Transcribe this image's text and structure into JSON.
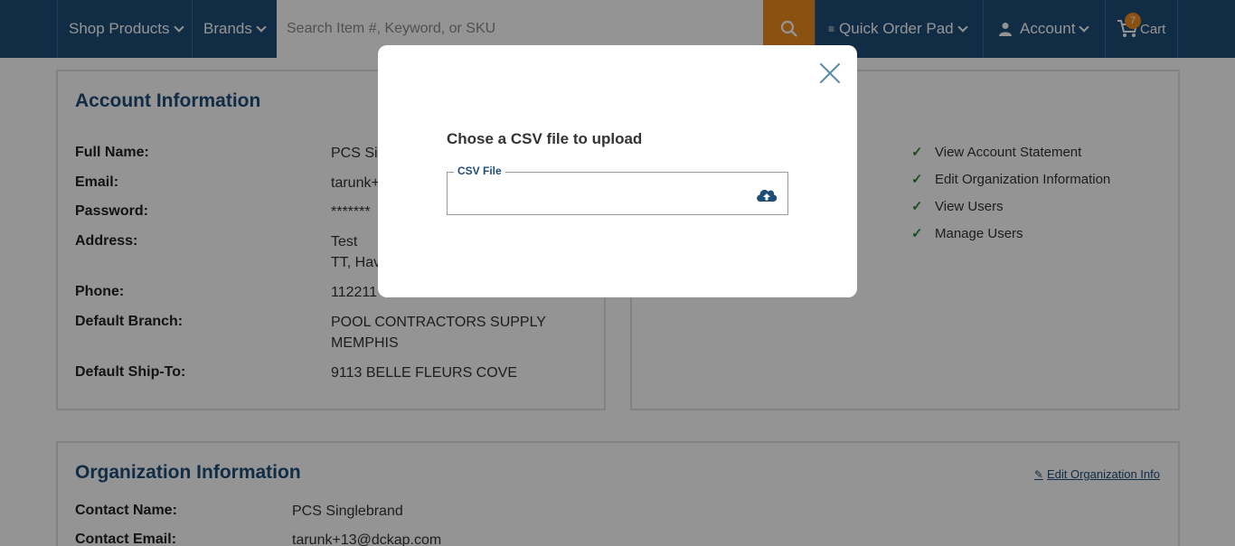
{
  "nav": {
    "shop_products": "Shop Products",
    "brands": "Brands",
    "search_placeholder": "Search Item #, Keyword, or SKU",
    "quick_order_pad": "Quick Order Pad",
    "account": "Account",
    "cart": "Cart",
    "cart_count": "7"
  },
  "account_info": {
    "title": "Account Information",
    "rows": [
      {
        "label": "Full Name:",
        "value": "PCS Sin"
      },
      {
        "label": "Email:",
        "value": "tarunk+"
      },
      {
        "label": "Password:",
        "value": "*******"
      },
      {
        "label": "Address:",
        "value_line1": "Test",
        "value_line2": "TT, Hav"
      },
      {
        "label": "Phone:",
        "value": "112211"
      },
      {
        "label": "Default Branch:",
        "value_line1": "POOL CONTRACTORS SUPPLY",
        "value_line2": "MEMPHIS"
      },
      {
        "label": "Default Ship-To:",
        "value": "9113 BELLE FLEURS COVE"
      }
    ]
  },
  "permissions": [
    "View Account Statement",
    "Edit Organization Information",
    "View Users",
    "Manage Users"
  ],
  "org_info": {
    "title": "Organization Information",
    "edit_link": "Edit Organization Info",
    "rows": [
      {
        "label": "Contact Name:",
        "value": "PCS Singlebrand"
      },
      {
        "label": "Contact Email:",
        "value": "tarunk+13@dckap.com"
      }
    ]
  },
  "modal": {
    "heading": "Chose a CSV file to upload",
    "field_label": "CSV File"
  },
  "colors": {
    "nav_bg": "#1e4d78",
    "accent": "#f08c1e",
    "check": "#2e8b3a"
  }
}
